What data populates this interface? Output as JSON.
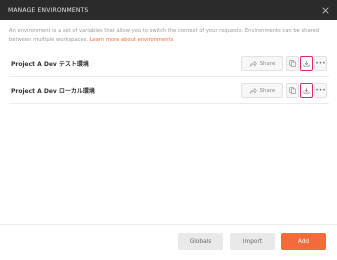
{
  "header": {
    "title": "MANAGE ENVIRONMENTS"
  },
  "description": {
    "text": "An environment is a set of variables that allow you to switch the context of your requests. Environments can be shared between multiple workspaces.",
    "link_text": "Learn more about environments"
  },
  "environments": [
    {
      "name": "Project A Dev テスト環境",
      "share_label": "Share"
    },
    {
      "name": "Project A Dev ローカル環境",
      "share_label": "Share"
    }
  ],
  "footer": {
    "globals_label": "Globals",
    "import_label": "Import",
    "add_label": "Add"
  },
  "colors": {
    "accent": "#f26b3a",
    "highlight": "#e4246e",
    "header_bg": "#2b2b2b"
  },
  "icons": [
    "close-icon",
    "share-icon",
    "copy-icon",
    "download-icon",
    "more-icon"
  ]
}
